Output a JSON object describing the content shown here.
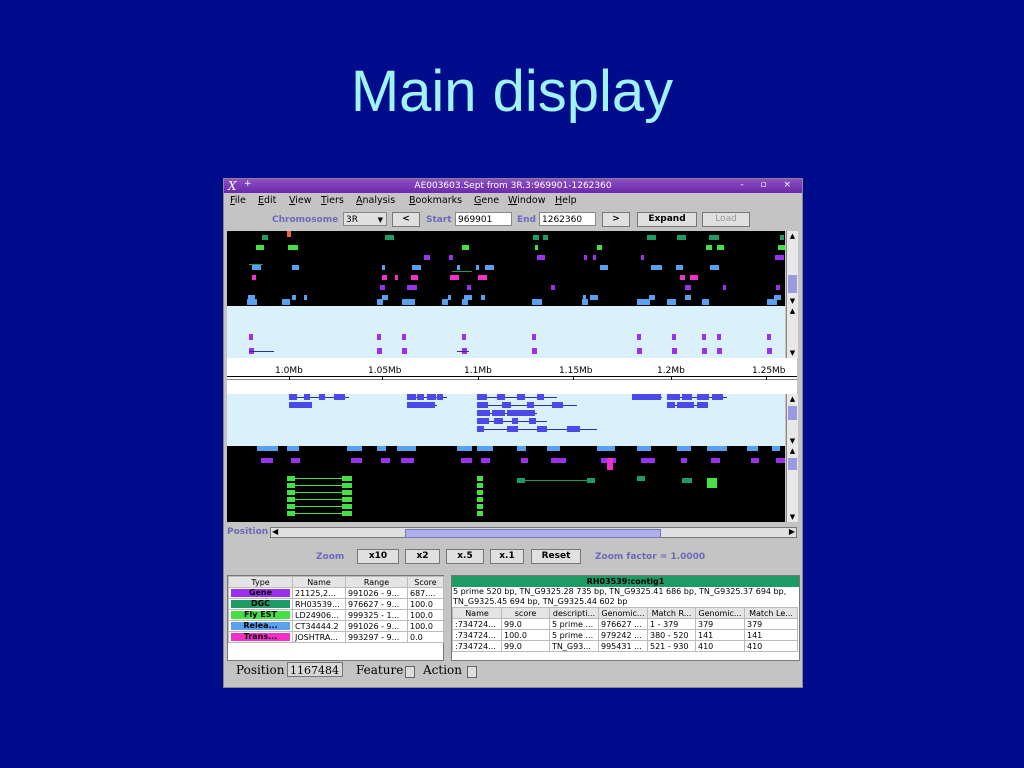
{
  "slide": {
    "title": "Main display"
  },
  "window": {
    "title": "AE003603.Sept from 3R.3:969901-1262360",
    "x_logo": "X",
    "pin": "+",
    "controls": "- ▫ ×"
  },
  "menu": [
    "File",
    "Edit",
    "View",
    "Tiers",
    "Analysis",
    "Bookmarks",
    "Gene",
    "Window",
    "Help"
  ],
  "nav": {
    "chromosome_label": "Chromosome",
    "chromosome_value": "3R",
    "prev_label": "<",
    "start_label": "Start",
    "start_value": "969901",
    "end_label": "End",
    "end_value": "1262360",
    "next_label": ">",
    "expand_label": "Expand",
    "load_label": "Load"
  },
  "ruler": {
    "ticks": [
      "1.0Mb",
      "1.05Mb",
      "1.1Mb",
      "1.15Mb",
      "1.2Mb",
      "1.25Mb"
    ]
  },
  "position": {
    "label": "Position"
  },
  "zoom": {
    "label": "Zoom",
    "buttons": [
      "x10",
      "x2",
      "x.5",
      "x.1"
    ],
    "reset_label": "Reset",
    "factor_text": "Zoom factor = 1.0000"
  },
  "type_table": {
    "headers": [
      "Type",
      "Name",
      "Range",
      "Score"
    ],
    "rows": [
      {
        "type": "Gene",
        "color": "#9b30f0",
        "name": "21125,2...",
        "range": "991026 - 9...",
        "score": "687...."
      },
      {
        "type": "DGC",
        "color": "#1e9a64",
        "name": "RH03539...",
        "range": "976627 - 9...",
        "score": "100.0"
      },
      {
        "type": "Fly EST",
        "color": "#44e044",
        "name": "LD24906...",
        "range": "999325 - 1...",
        "score": "100.0"
      },
      {
        "type": "Relea...",
        "color": "#5aa0f0",
        "name": "CT34444.2",
        "range": "991026 - 9...",
        "score": "100.0"
      },
      {
        "type": "Trans...",
        "color": "#f030c8",
        "name": "JOSHTRA...",
        "range": "993297 - 9...",
        "score": "0.0"
      }
    ]
  },
  "detail": {
    "header": "RH03539:contig1",
    "description": "5 prime 520 bp, TN_G9325.28 735 bp, TN_G9325.41 686 bp, TN_G9325.37 694 bp, TN_G9325.45 694 bp, TN_G9325.44 602 bp",
    "headers": [
      "Name",
      "score",
      "descripti...",
      "Genomic...",
      "Match R...",
      "Genomic...",
      "Match Le..."
    ],
    "rows": [
      [
        ":734724...",
        "99.0",
        "5 prime ...",
        "976627 ...",
        "1 - 379",
        "379",
        "379"
      ],
      [
        ":734724...",
        "100.0",
        "5 prime ...",
        "979242 ...",
        "380 - 520",
        "141",
        "141"
      ],
      [
        ":734724...",
        "99.0",
        "TN_G93...",
        "995431 ...",
        "521 - 930",
        "410",
        "410"
      ]
    ]
  },
  "status": {
    "position_label": "Position",
    "position_value": "1167484",
    "feature_label": "Feature",
    "action_label": "Action"
  },
  "colors": {
    "background": "#000C8C",
    "title": "#9FF3F3",
    "gene": "#9b30f0",
    "dgc": "#1e9a64",
    "est": "#44e044",
    "release": "#5aa0f0",
    "transcript": "#f030c8"
  }
}
